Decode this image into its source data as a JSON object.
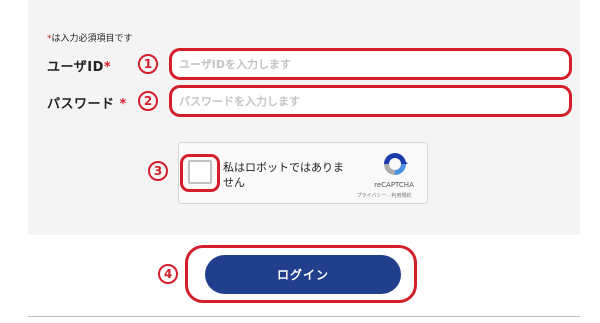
{
  "form": {
    "required_note_star": "*",
    "required_note": "は入力必須項目です",
    "user_id": {
      "label": "ユーザID",
      "required_mark": "*",
      "step": "1",
      "placeholder": "ユーザIDを入力します",
      "value": ""
    },
    "password": {
      "label": "パスワード",
      "required_mark": "*",
      "step": "2",
      "placeholder": "パスワードを入力します",
      "value": ""
    }
  },
  "captcha": {
    "step": "3",
    "label": "私はロボットではありません",
    "checked": false,
    "brand": "reCAPTCHA",
    "links": "プライバシー - 利用規約",
    "logo_icon": "recaptcha-logo-icon"
  },
  "login": {
    "step": "4",
    "button_label": "ログイン"
  },
  "colors": {
    "accent_red": "#d21f2b",
    "button_blue": "#213f8c",
    "panel_bg": "#f4f4f4"
  }
}
